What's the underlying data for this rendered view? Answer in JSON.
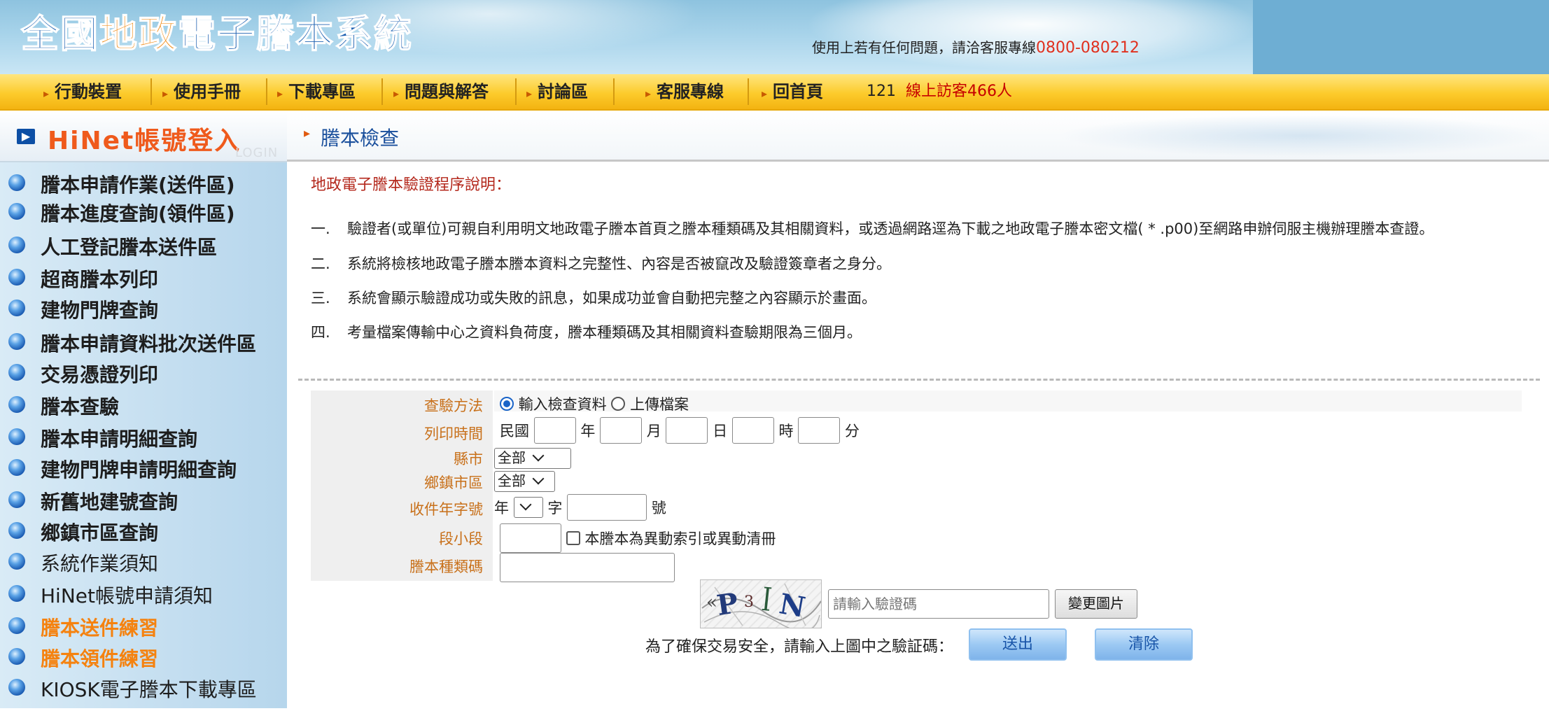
{
  "header": {
    "logo_parts": [
      "全國",
      "地政",
      "電子謄本系統"
    ],
    "hotline_text": "使用上若有任何問題，請洽客服專線",
    "hotline_number": "0800-080212"
  },
  "topnav": {
    "items": [
      "行動裝置",
      "使用手冊",
      "下載專區",
      "問題與解答",
      "討論區",
      "客服專線",
      "回首頁"
    ],
    "counter_number": "121",
    "counter_text": "線上訪客466人"
  },
  "sidebar": {
    "login_title": "HiNet帳號登入",
    "login_sub": "LOGIN",
    "items": [
      "謄本申請作業(送件區)",
      "謄本進度查詢(領件區)",
      "人工登記謄本送件區",
      "超商謄本列印",
      "建物門牌查詢",
      "謄本申請資料批次送件區",
      "交易憑證列印",
      "謄本查驗",
      "謄本申請明細查詢",
      "建物門牌申請明細查詢",
      "新舊地建號查詢",
      "鄉鎮市區查詢",
      "系統作業須知",
      "HiNet帳號申請須知",
      "謄本送件練習",
      "謄本領件練習",
      "KIOSK電子謄本下載專區"
    ]
  },
  "main": {
    "section_title": "謄本檢查",
    "intro_heading": "地政電子謄本驗證程序說明：",
    "intro_lines": [
      {
        "num": "一.",
        "text": "驗證者(或單位)可親自利用明文地政電子謄本首頁之謄本種類碼及其相關資料，或透過網路逕為下載之地政電子謄本密文檔( * .p00)至網路申辦伺服主機辦理謄本查證。"
      },
      {
        "num": "二.",
        "text": "系統將檢核地政電子謄本謄本資料之完整性、內容是否被竄改及驗證簽章者之身分。"
      },
      {
        "num": "三.",
        "text": "系統會顯示驗證成功或失敗的訊息，如果成功並會自動把完整之內容顯示於畫面。"
      },
      {
        "num": "四.",
        "text": "考量檔案傳輸中心之資料負荷度，謄本種類碼及其相關資料查驗期限為三個月。"
      }
    ]
  },
  "form": {
    "labels": {
      "method": "查驗方法",
      "print_time": "列印時間",
      "county": "縣市",
      "district": "鄉鎮市區",
      "receipt_no": "收件年字號",
      "section": "段小段",
      "type_code": "謄本種類碼"
    },
    "method_options": [
      "輸入檢查資料",
      "上傳檔案"
    ],
    "method_selected": "輸入檢查資料",
    "time_units": {
      "era": "民國",
      "year": "年",
      "month": "月",
      "day": "日",
      "hour": "時",
      "minute": "分"
    },
    "county_selected": "全部",
    "district_selected": "全部",
    "receipt": {
      "year": "年",
      "char": "字",
      "no": "號"
    },
    "section_checkbox_label": "本謄本為異動索引或異動清冊",
    "captcha_text": "P3N",
    "captcha_placeholder": "請輸入驗證碼",
    "change_image_label": "變更圖片",
    "security_note": "為了確保交易安全，請輸入上圖中之驗証碼：",
    "submit_label": "送出",
    "clear_label": "清除"
  }
}
